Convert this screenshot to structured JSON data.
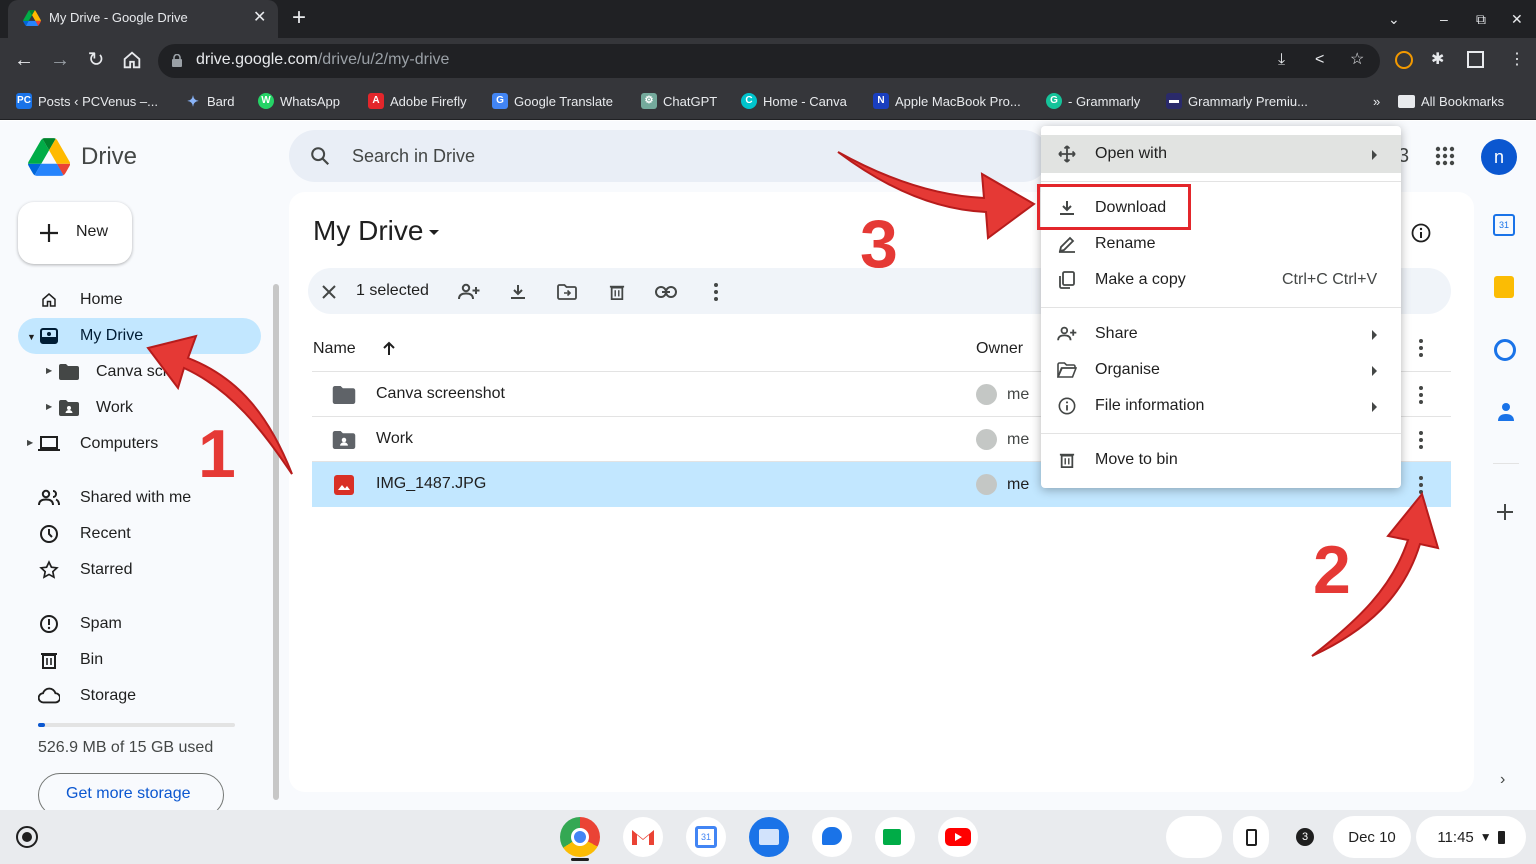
{
  "browser": {
    "tab_title": "My Drive - Google Drive",
    "url_host": "drive.google.com",
    "url_path": "/drive/u/2/my-drive",
    "bookmarks": [
      {
        "label": "Posts ‹ PCVenus –...",
        "fav": "PC",
        "color": "#1a73e8"
      },
      {
        "label": "Bard",
        "fav": "✦",
        "color": "#7b61ff"
      },
      {
        "label": "WhatsApp",
        "fav": "W",
        "color": "#25d366"
      },
      {
        "label": "Adobe Firefly",
        "fav": "A",
        "color": "#e3262b"
      },
      {
        "label": "Google Translate",
        "fav": "G",
        "color": "#4285f4"
      },
      {
        "label": "ChatGPT",
        "fav": "⚙",
        "color": "#74aa9c"
      },
      {
        "label": "Home - Canva",
        "fav": "C",
        "color": "#00c4cc"
      },
      {
        "label": "Apple MacBook Pro...",
        "fav": "N",
        "color": "#1a3fbf"
      },
      {
        "label": "- Grammarly",
        "fav": "G",
        "color": "#15c39a"
      },
      {
        "label": "Grammarly Premiu...",
        "fav": "▬",
        "color": "#2a2a6a"
      }
    ],
    "all_bookmarks": "All Bookmarks",
    "overflow": "»"
  },
  "drive": {
    "logo": "Drive",
    "search_placeholder": "Search in Drive",
    "new_label": "New",
    "nav": {
      "home": "Home",
      "my_drive": "My Drive",
      "canva": "Canva scr",
      "work": "Work",
      "computers": "Computers",
      "shared": "Shared with me",
      "recent": "Recent",
      "starred": "Starred",
      "spam": "Spam",
      "bin": "Bin",
      "storage": "Storage"
    },
    "storage_used": "526.9 MB of 15 GB used",
    "storage_fraction": 0.035,
    "get_more": "Get more storage",
    "title": "My Drive",
    "selected": "1 selected",
    "col_name": "Name",
    "col_owner": "Owner",
    "rows": [
      {
        "name": "Canva screenshot",
        "owner": "me",
        "type": "folder"
      },
      {
        "name": "Work",
        "owner": "me",
        "type": "shared-folder"
      },
      {
        "name": "IMG_1487.JPG",
        "owner": "me",
        "type": "image",
        "selected": true
      }
    ],
    "avatar_initial": "n",
    "header_partial_digit": "3"
  },
  "menu": {
    "open_with": "Open with",
    "download": "Download",
    "rename": "Rename",
    "make_copy": "Make a copy",
    "make_copy_shortcut": "Ctrl+C Ctrl+V",
    "share": "Share",
    "organise": "Organise",
    "file_info": "File information",
    "move_to_bin": "Move to bin"
  },
  "annotations": {
    "step1": "1",
    "step2": "2",
    "step3": "3",
    "accent": "#e53935"
  },
  "shelf": {
    "date": "Dec 10",
    "time": "11:45",
    "notifications": "3"
  }
}
